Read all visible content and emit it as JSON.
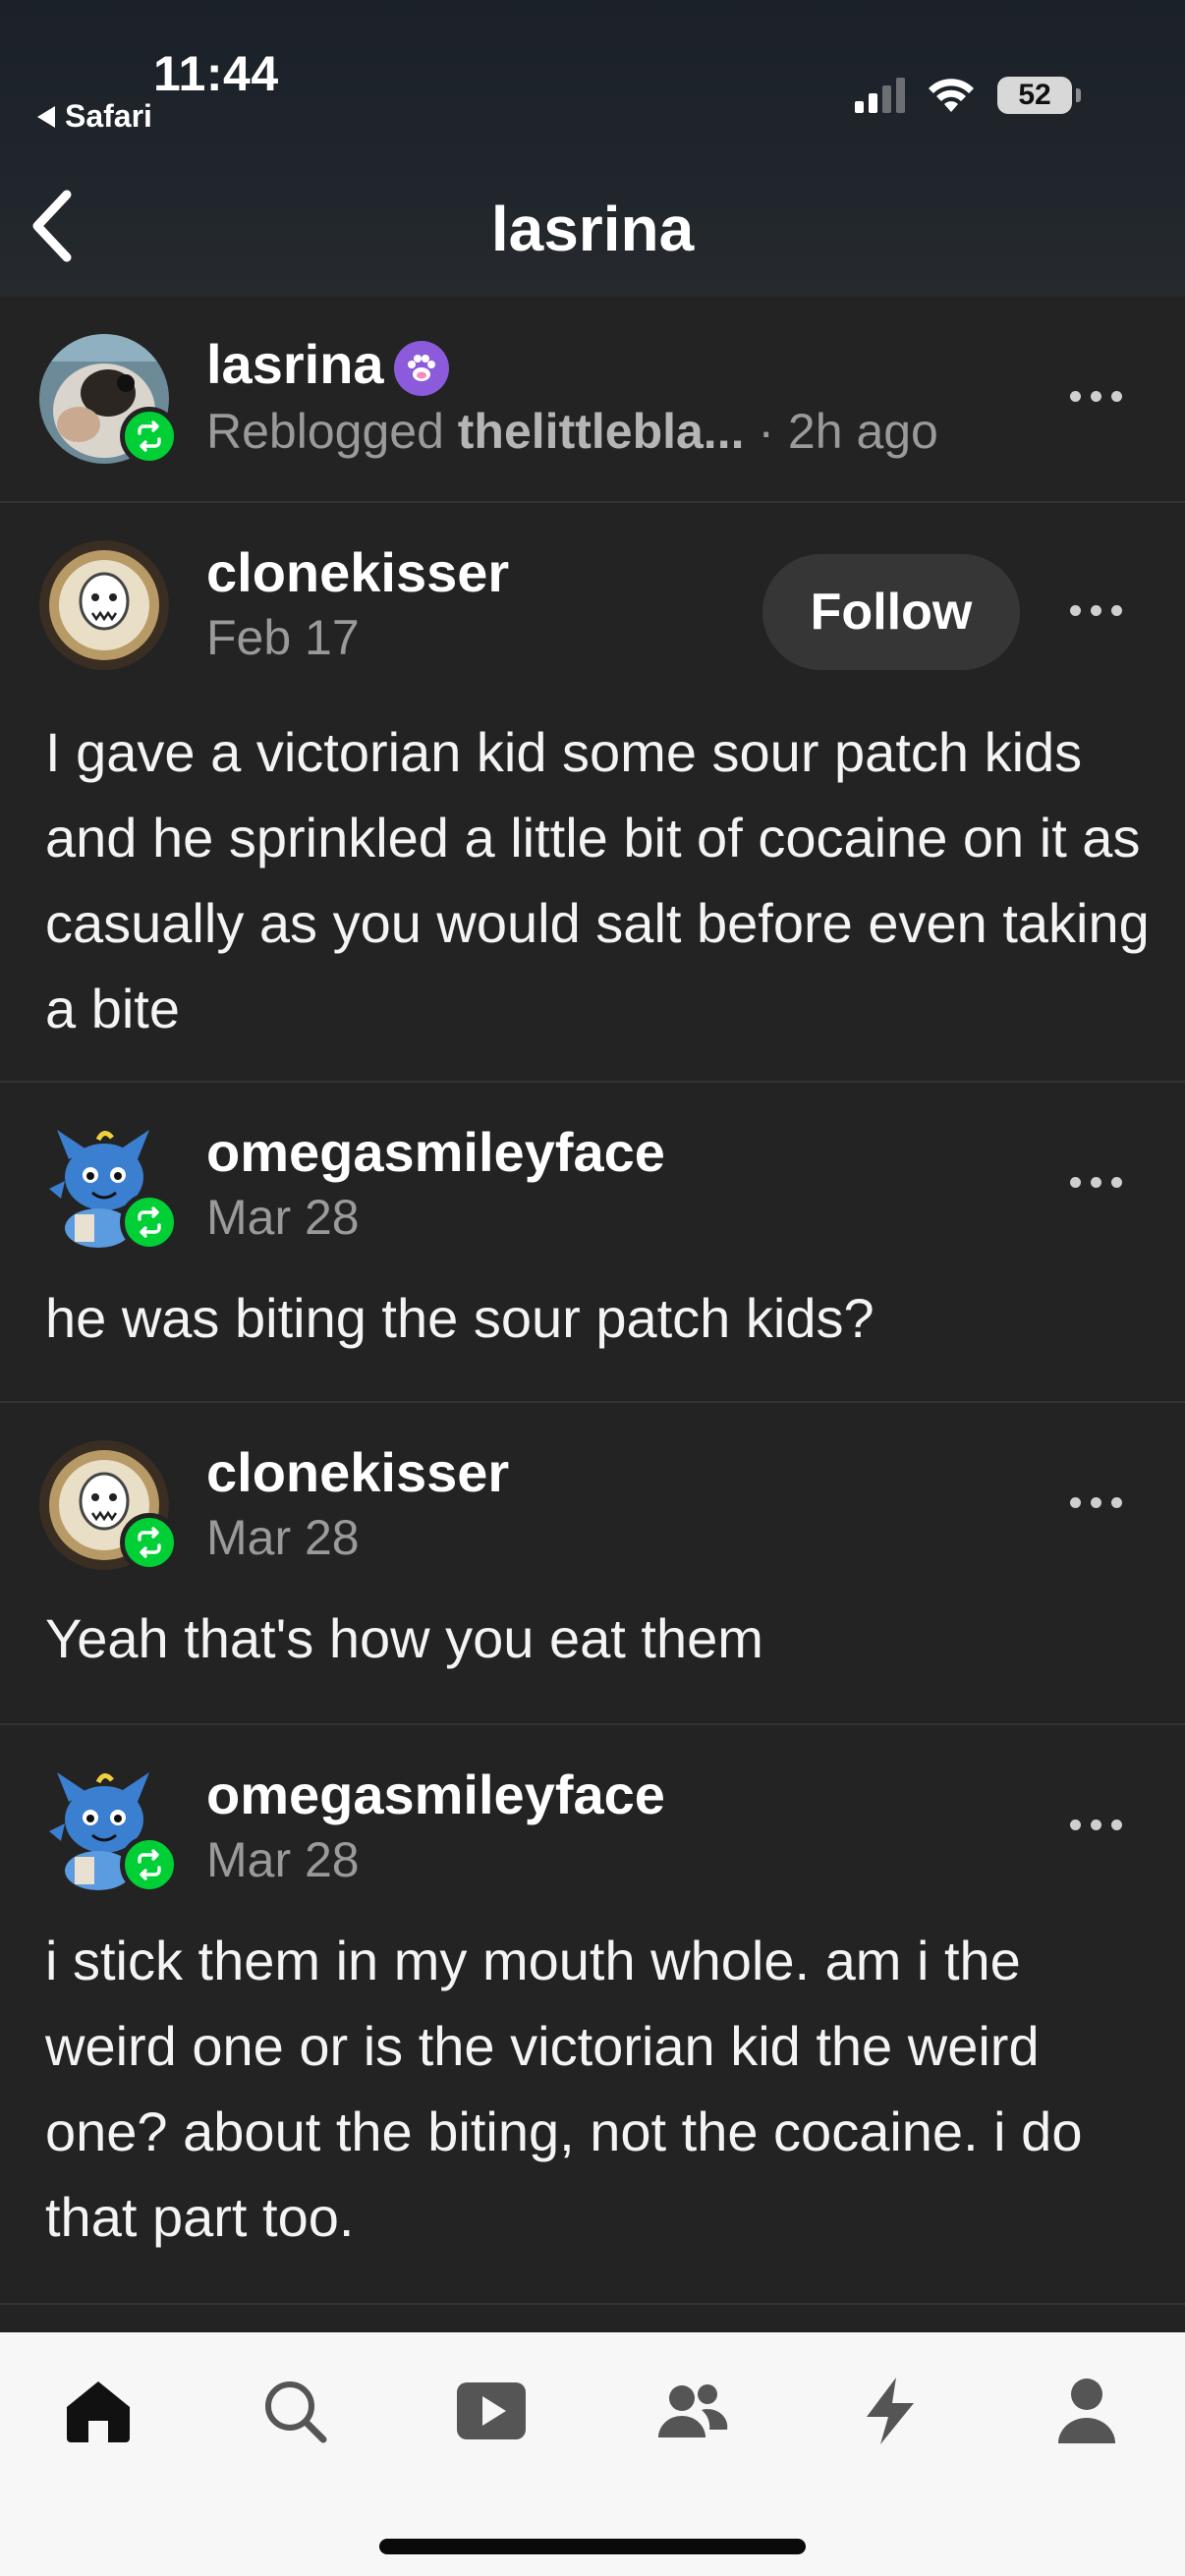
{
  "status_bar": {
    "time": "11:44",
    "back_app": "Safari",
    "battery": "52"
  },
  "nav": {
    "title": "lasrina"
  },
  "reblog_header": {
    "username": "lasrina",
    "reblogged_label": "Reblogged",
    "reblogged_from": "thelittlebla...",
    "time_ago": "· 2h ago"
  },
  "posts": [
    {
      "username": "clonekisser",
      "date": "Feb 17",
      "follow_label": "Follow",
      "text": "I gave a victorian kid some sour patch kids and he sprinkled a little bit of cocaine on it as casually as you would salt before even taking a bite"
    },
    {
      "username": "omegasmileyface",
      "date": "Mar 28",
      "text": "he was biting the sour patch kids?"
    },
    {
      "username": "clonekisser",
      "date": "Mar 28",
      "text": "Yeah that's how you eat them"
    },
    {
      "username": "omegasmileyface",
      "date": "Mar 28",
      "text": "i stick them in my mouth whole. am i the weird one or is the victorian kid the weird one? about the biting, not the cocaine. i do that part too."
    }
  ],
  "tabbar": {
    "items": [
      "home-icon",
      "search-icon",
      "video-icon",
      "community-icon",
      "activity-icon",
      "account-icon"
    ]
  },
  "colors": {
    "background": "#232323",
    "reblog_green": "#00cf35",
    "muted_text": "#9a9a9a",
    "tabbar_bg": "#f7f7f8"
  }
}
